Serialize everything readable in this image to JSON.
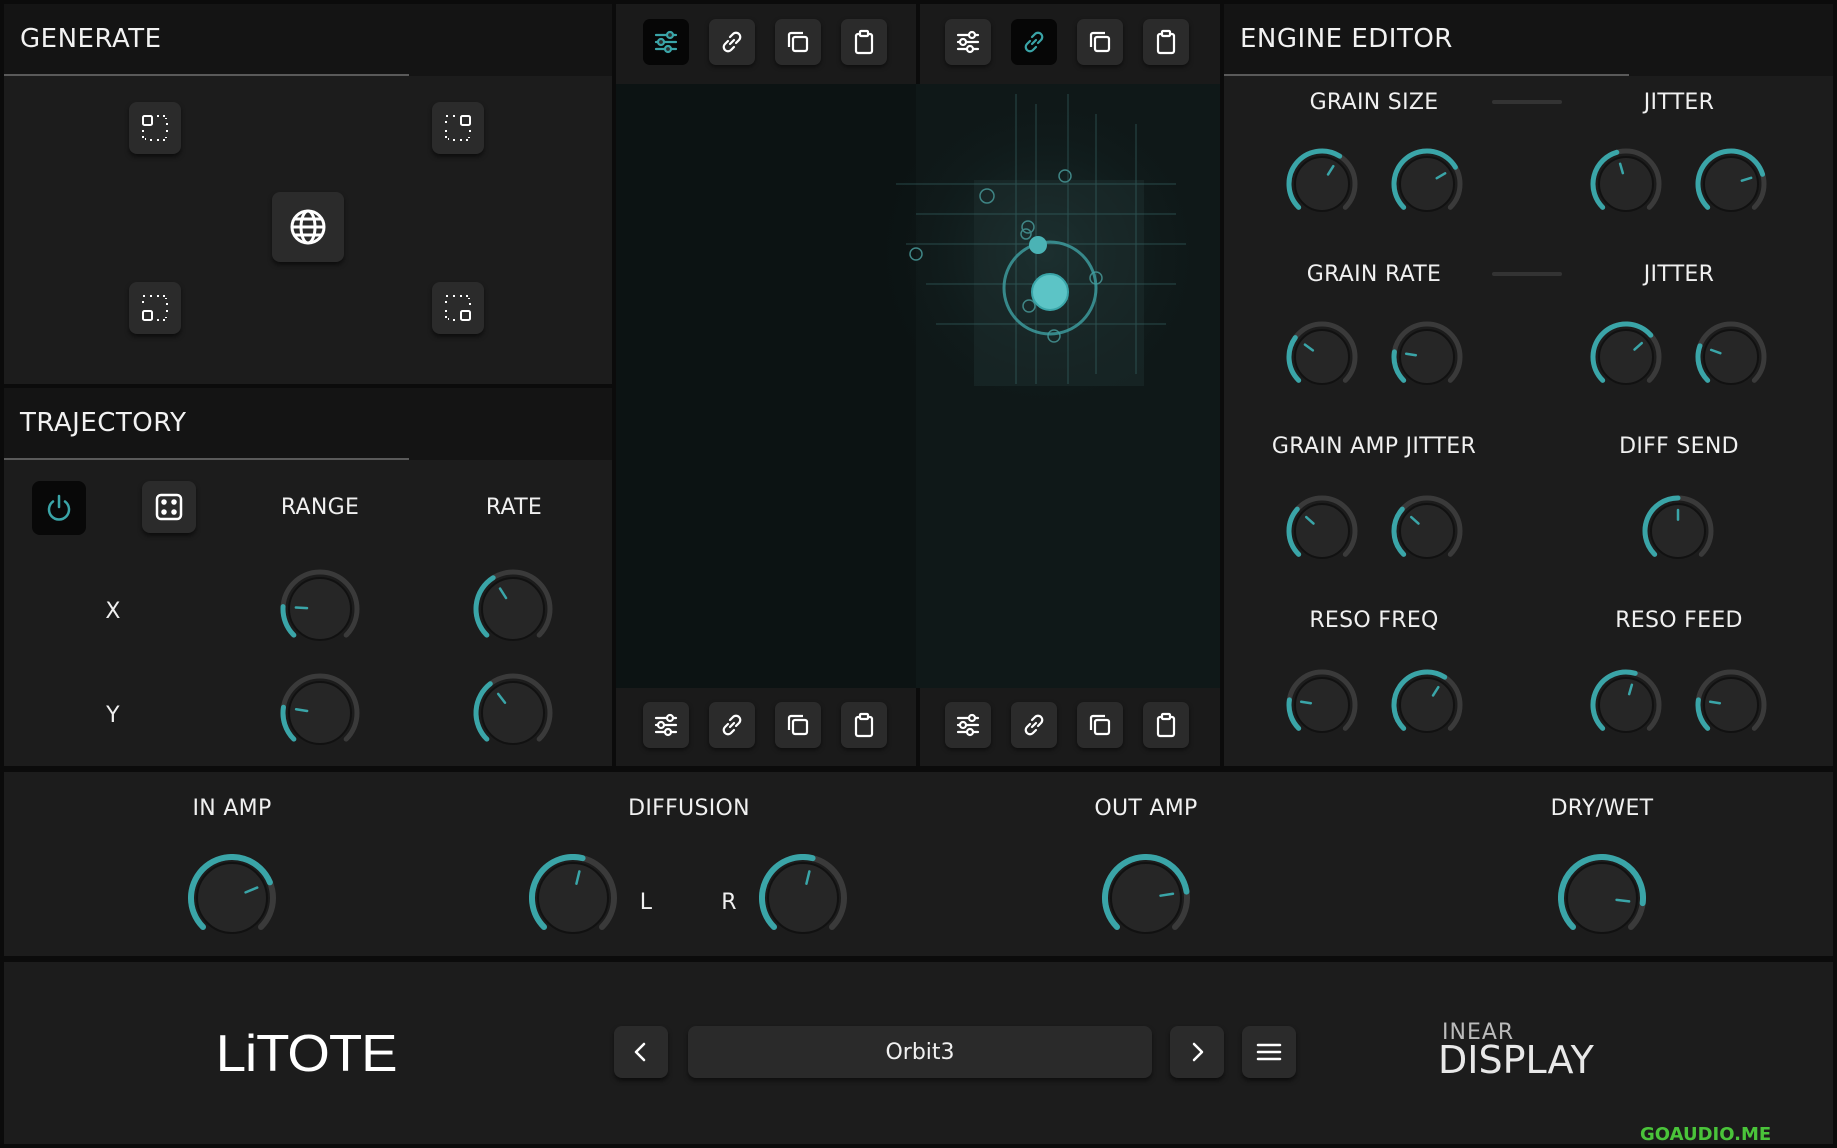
{
  "generate": {
    "title": "GENERATE"
  },
  "trajectory": {
    "title": "TRAJECTORY",
    "col_range": "RANGE",
    "col_rate": "RATE",
    "row_x": "X",
    "row_y": "Y"
  },
  "engine": {
    "title": "ENGINE EDITOR",
    "grain_size": "GRAIN SIZE",
    "jitter_1": "JITTER",
    "grain_rate": "GRAIN RATE",
    "jitter_2": "JITTER",
    "grain_amp_jitter": "GRAIN AMP JITTER",
    "diff_send": "DIFF SEND",
    "reso_freq": "RESO FREQ",
    "reso_feed": "RESO FEED"
  },
  "main": {
    "in_amp": "IN AMP",
    "diffusion": "DIFFUSION",
    "out_amp": "OUT AMP",
    "dry_wet": "DRY/WET",
    "left": "L",
    "right": "R"
  },
  "footer": {
    "logo": "LiTOTE",
    "preset": "Orbit3",
    "brand_top": "INEAR",
    "brand_bottom": "DISPLAY",
    "watermark": "GOAUDIO.ME"
  },
  "colors": {
    "accent": "#3aa5a8",
    "panel": "#1c1c1c",
    "header": "#141414"
  },
  "knob_values": {
    "traj_x_range": 0.18,
    "traj_x_rate": 0.38,
    "traj_y_range": 0.2,
    "traj_y_rate": 0.36,
    "gs_1": 0.62,
    "gs_2": 0.72,
    "gs_3": 0.44,
    "gs_4": 0.77,
    "gr_1": 0.3,
    "gr_2": 0.2,
    "gr_3": 0.68,
    "gr_4": 0.24,
    "gaj_1": 0.32,
    "gaj_2": 0.32,
    "diff_send": 0.5,
    "rf_1": 0.2,
    "rf_2": 0.62,
    "rfe_1": 0.56,
    "rfe_2": 0.2,
    "in_amp": 0.75,
    "diff_l": 0.55,
    "diff_r": 0.55,
    "out_amp": 0.8,
    "dry_wet": 0.86
  }
}
